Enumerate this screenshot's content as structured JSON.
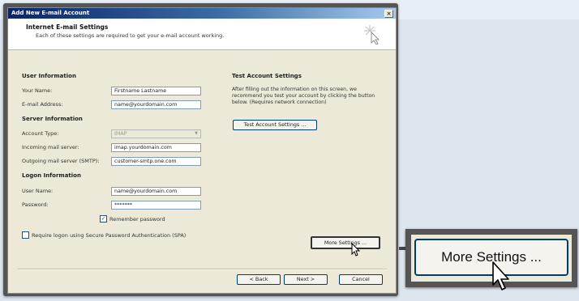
{
  "dialog": {
    "title": "Add New E-mail Account",
    "close_glyph": "×",
    "header_title": "Internet E-mail Settings",
    "header_subtitle": "Each of these settings are required to get your e-mail account working."
  },
  "user_info": {
    "heading": "User Information",
    "name_label": "Your Name:",
    "name_value": "Firstname Lastname",
    "email_label": "E-mail Address:",
    "email_value": "name@yourdomain.com"
  },
  "server_info": {
    "heading": "Server Information",
    "account_type_label": "Account Type:",
    "account_type_value": "IMAP",
    "incoming_label": "Incoming mail server:",
    "incoming_value": "imap.yourdomain.com",
    "outgoing_label": "Outgoing mail server (SMTP):",
    "outgoing_value": "customer-smtp.one.com"
  },
  "logon_info": {
    "heading": "Logon Information",
    "username_label": "User Name:",
    "username_value": "name@yourdomain.com",
    "password_label": "Password:",
    "password_value": "*******",
    "remember_label": "Remember password",
    "remember_checked": true,
    "spa_label": "Require logon using Secure Password Authentication (SPA)",
    "spa_checked": false
  },
  "test_settings": {
    "heading": "Test Account Settings",
    "description": "After filling out the information on this screen, we recommend you test your account by clicking the button below. (Requires network connection)",
    "test_button": "Test Account Settings ..."
  },
  "buttons": {
    "more_settings": "More Settings ...",
    "back": "< Back",
    "next": "Next >",
    "cancel": "Cancel"
  },
  "zoom_callout": {
    "label": "More Settings ..."
  },
  "colors": {
    "titlebar_start": "#0a246a",
    "dialog_bg": "#ece9d8",
    "button_border": "#003c74",
    "frame": "#555555"
  },
  "icons": [
    "close-icon",
    "wizard-sparkle-icon",
    "checkbox-checked-icon",
    "checkbox-icon",
    "mouse-cursor-icon"
  ]
}
